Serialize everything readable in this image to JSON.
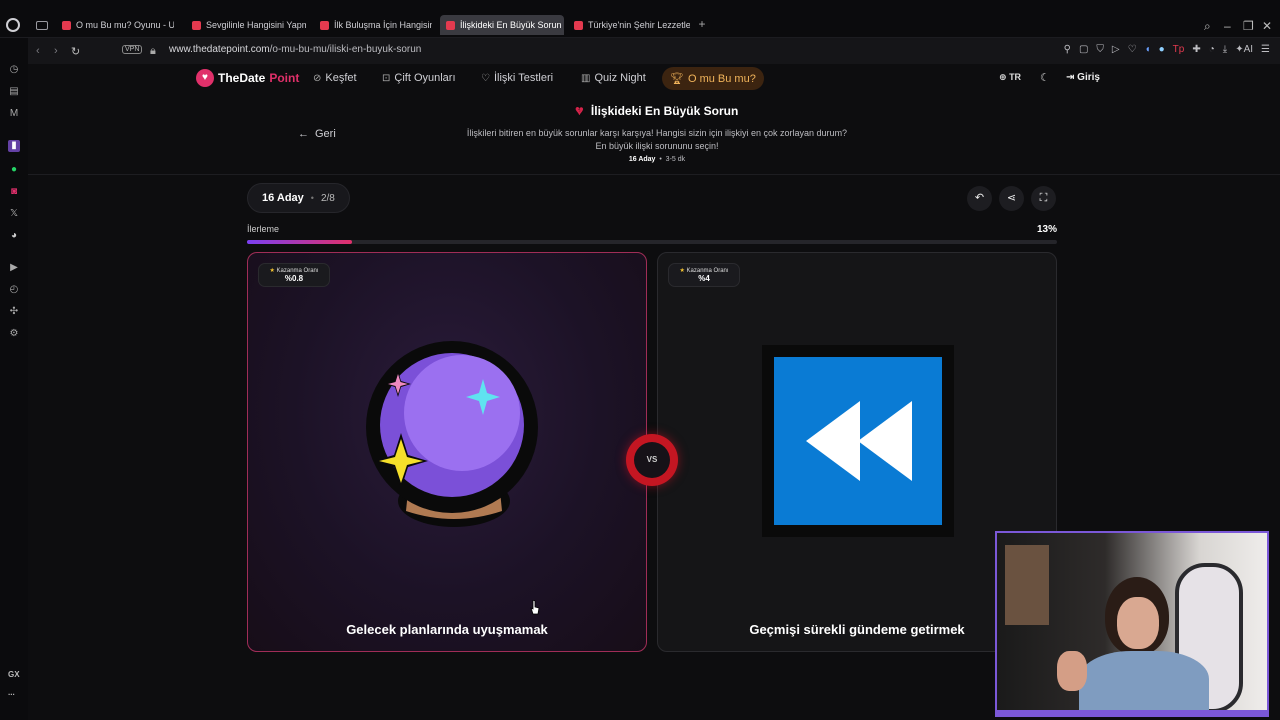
{
  "browser": {
    "tabs": [
      {
        "label": "O mu Bu mu? Oyunu - Uw"
      },
      {
        "label": "Sevgilinle Hangisini Yapm"
      },
      {
        "label": "İlk Buluşma İçin Hangisini"
      },
      {
        "label": "İlişkideki En Büyük Sorun"
      },
      {
        "label": "Türkiye'nin Şehir Lezzetle"
      }
    ],
    "new_tab": "+",
    "vpn": "VPN",
    "url_host": "www.thedatepoint.com",
    "url_path": "/o-mu-bu-mu/iliski-en-buyuk-sorun",
    "ai_label": "AI",
    "gx_label": "GX",
    "more_label": "..."
  },
  "site": {
    "logo_the": "TheDate",
    "logo_point": "Point",
    "nav": {
      "explore": "Keşfet",
      "couple_games": "Çift Oyunları",
      "relationship_tests": "İlişki Testleri",
      "quiz_night": "Quiz Night",
      "this_or_that": "O mu Bu mu?"
    },
    "lang": "TR",
    "login": "Giriş"
  },
  "page": {
    "back": "Geri",
    "title": "İlişkideki En Büyük Sorun",
    "description": "İlişkileri bitiren en büyük sorunlar karşı karşıya! Hangisi sizin için ilişkiyi en çok zorlayan durum? En büyük ilişki sorununu seçin!",
    "candidates": "16 Aday",
    "duration": "3-5 dk"
  },
  "game": {
    "candidates_label": "16 Aday",
    "round": "2/8",
    "progress_label": "İlerleme",
    "progress_text": "13%",
    "progress_value": 0.13,
    "vs": "VS",
    "left": {
      "winrate_label": "Kazanma Oranı",
      "winrate": "%0.8",
      "caption": "Gelecek planlarında uyuşmamak",
      "icon": "crystal-ball-icon"
    },
    "right": {
      "winrate_label": "Kazanma Oranı",
      "winrate": "%4",
      "caption": "Geçmişi sürekli gündeme getirmek",
      "icon": "rewind-icon"
    }
  },
  "colors": {
    "accent": "#e0306a",
    "active_nav": "#f0b35a",
    "vs": "#c41622",
    "rewind_blue": "#0a7bd4"
  }
}
